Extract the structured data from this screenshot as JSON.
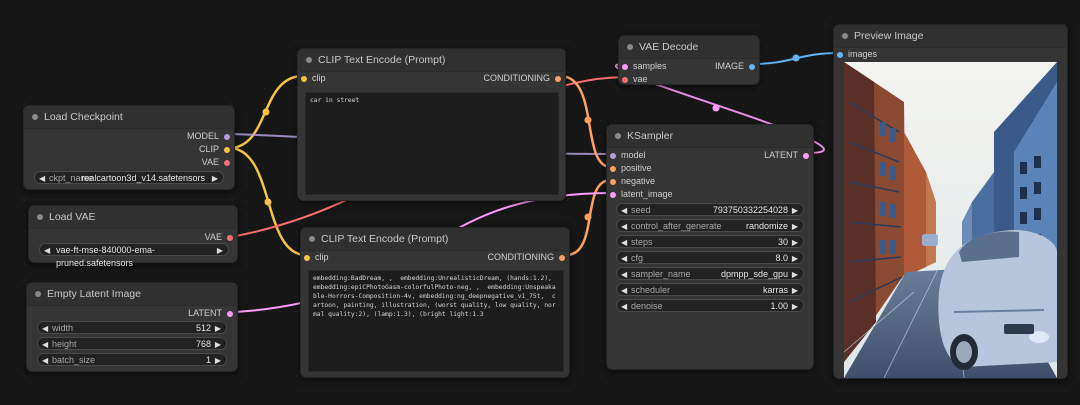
{
  "colors": {
    "clip": "#f6c344",
    "model": "#b39ddb",
    "vae": "#ff6e6e",
    "cond": "#ffa060",
    "latent": "#ff9cf9",
    "image": "#64b5f6"
  },
  "nodes": {
    "load_checkpoint": {
      "title": "Load Checkpoint",
      "outputs": [
        "MODEL",
        "CLIP",
        "VAE"
      ],
      "widget": {
        "label": "ckpt_name",
        "value": "realcartoon3d_v14.safetensors"
      }
    },
    "load_vae": {
      "title": "Load VAE",
      "output": "VAE",
      "widget": {
        "value": "vae-ft-mse-840000-ema-pruned.safetensors"
      }
    },
    "empty_latent": {
      "title": "Empty Latent Image",
      "output": "LATENT",
      "widgets": [
        {
          "label": "width",
          "value": "512"
        },
        {
          "label": "height",
          "value": "768"
        },
        {
          "label": "batch_size",
          "value": "1"
        }
      ]
    },
    "clip_pos": {
      "title": "CLIP Text Encode (Prompt)",
      "input": "clip",
      "output": "CONDITIONING",
      "text": "car in street"
    },
    "clip_neg": {
      "title": "CLIP Text Encode (Prompt)",
      "input": "clip",
      "output": "CONDITIONING",
      "text": "embedding:BadDream, ,  embedding:UnrealisticDream, (hands:1.2), embedding:epiCPhotoGasm-colorfulPhoto-neg, ,  embedding:Unspeakable-Horrors-Composition-4v, embedding:ng_deepnegative_v1_75t,  cartoon, painting, illustration, (worst quality, low quality, normal quality:2), (lamp:1.3), (bright light:1.3"
    },
    "vae_decode": {
      "title": "VAE Decode",
      "inputs": [
        "samples",
        "vae"
      ],
      "output": "IMAGE"
    },
    "ksampler": {
      "title": "KSampler",
      "inputs": [
        "model",
        "positive",
        "negative",
        "latent_image"
      ],
      "output": "LATENT",
      "widgets": [
        {
          "label": "seed",
          "value": "793750332254028"
        },
        {
          "label": "control_after_generate",
          "value": "randomize"
        },
        {
          "label": "steps",
          "value": "30"
        },
        {
          "label": "cfg",
          "value": "8.0"
        },
        {
          "label": "sampler_name",
          "value": "dpmpp_sde_gpu"
        },
        {
          "label": "scheduler",
          "value": "karras"
        },
        {
          "label": "denoise",
          "value": "1.00"
        }
      ]
    },
    "preview": {
      "title": "Preview Image",
      "input": "images"
    }
  }
}
